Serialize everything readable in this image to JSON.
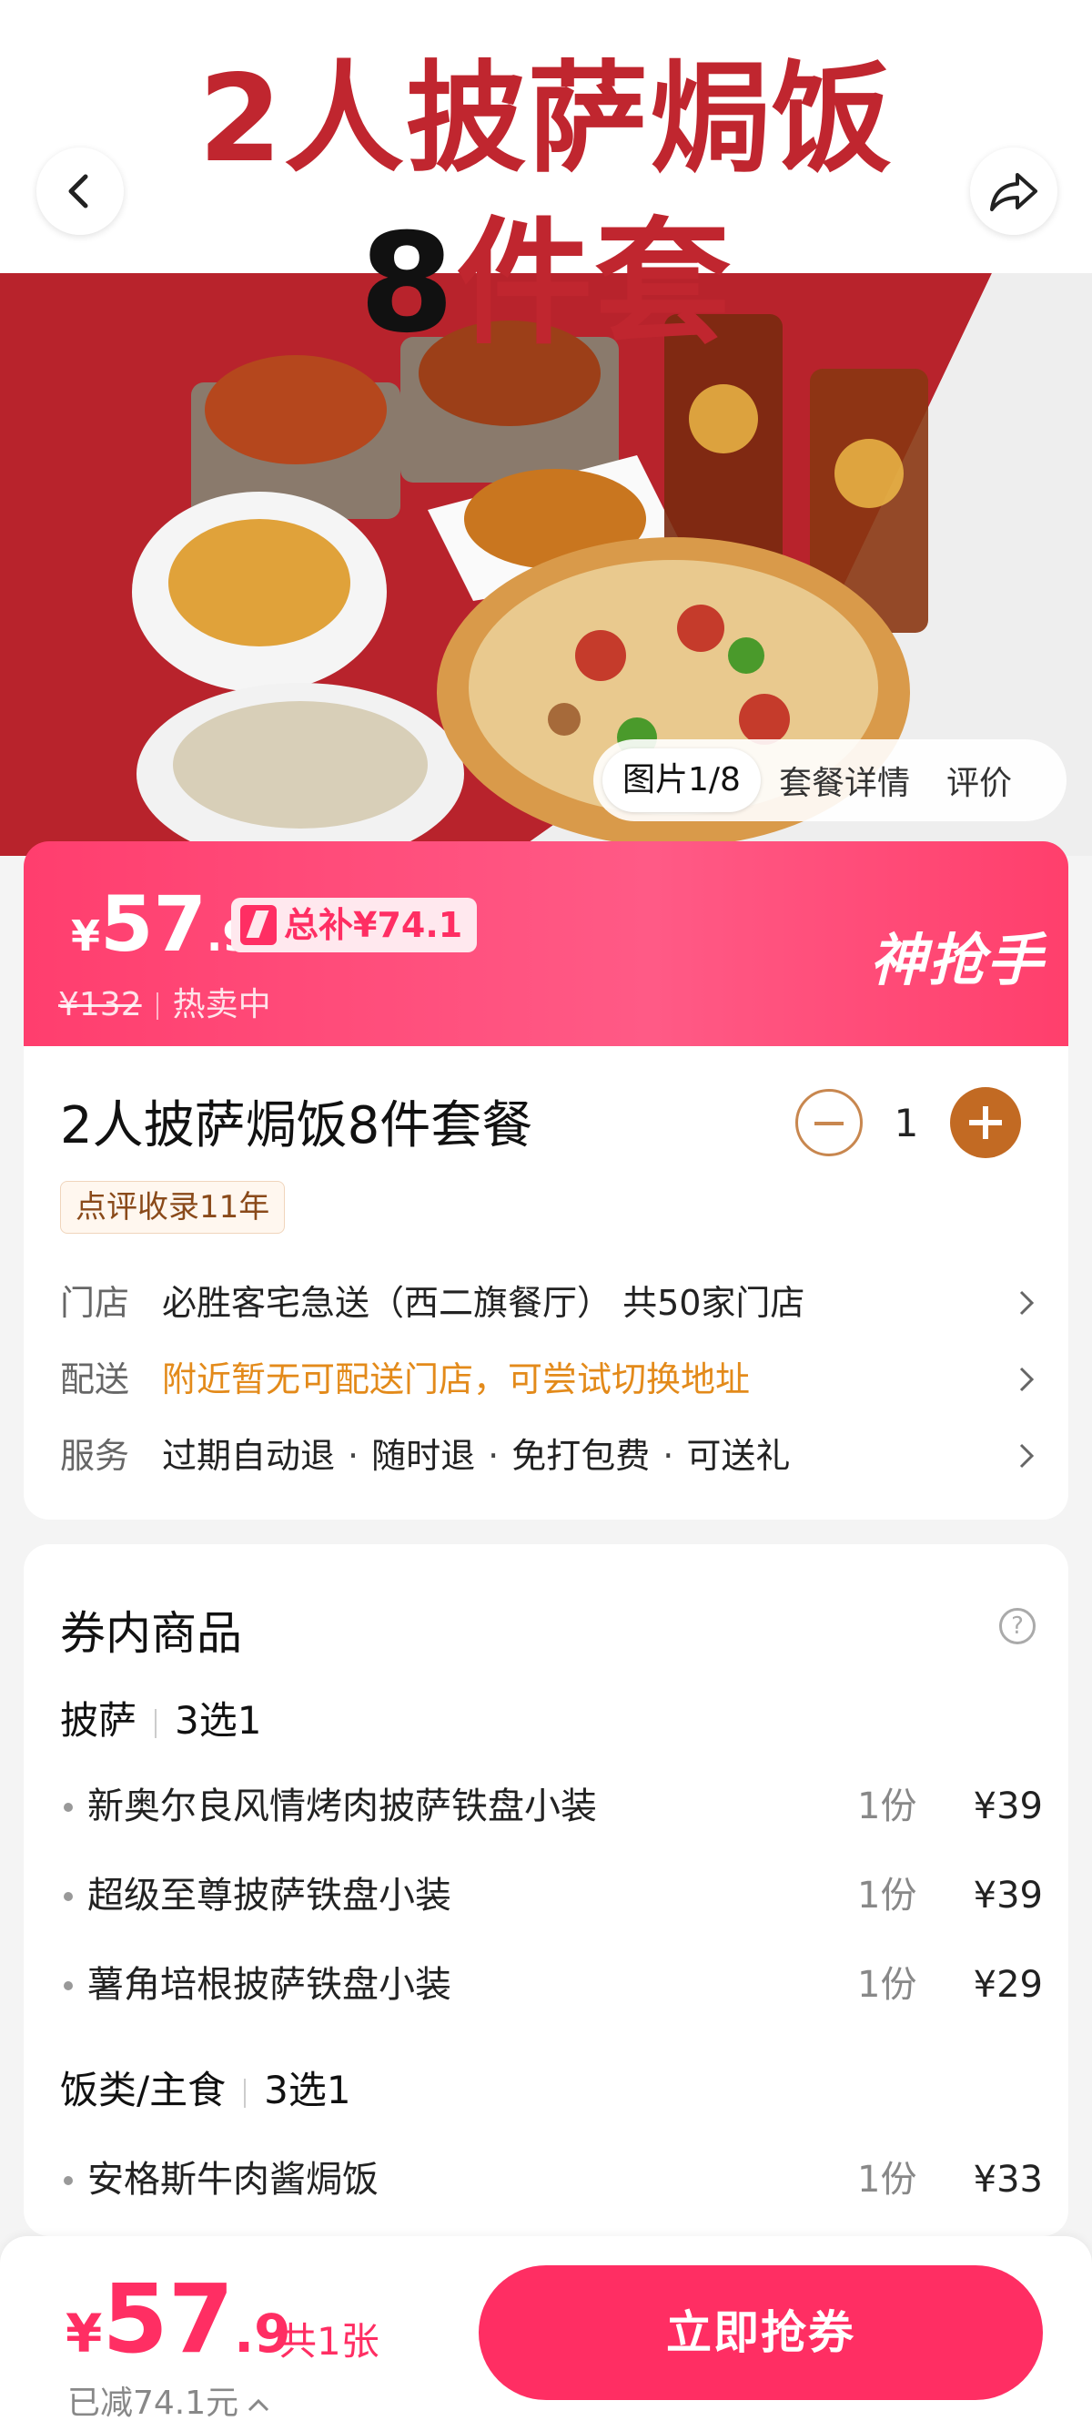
{
  "hero": {
    "title_line1": "2人披萨焗饭",
    "title_line2_num": "8",
    "title_line2_text": "件套",
    "tabs": [
      "图片1/8",
      "套餐详情",
      "评价"
    ],
    "active_tab": "图片1/8"
  },
  "price_banner": {
    "currency": "¥",
    "price_int": "57",
    "price_dec": ".9",
    "subsidy": "总补¥74.1",
    "original_price": "¥132",
    "status": "热卖中",
    "brand": "神抢手"
  },
  "product": {
    "title": "2人披萨焗饭8件套餐",
    "quantity": "1",
    "tag": "点评收录11年",
    "store_label": "门店",
    "store_value": "必胜客宅急送（西二旗餐厅）  共50家门店",
    "delivery_label": "配送",
    "delivery_value": "附近暂无可配送门店，可尝试切换地址",
    "service_label": "服务",
    "services": [
      "过期自动退",
      "随时退",
      "免打包费",
      "可送礼"
    ],
    "service_sep": "·"
  },
  "coupon_items": {
    "heading": "券内商品",
    "groups": [
      {
        "name": "披萨",
        "rule": "3选1",
        "items": [
          {
            "name": "新奥尔良风情烤肉披萨铁盘小装",
            "qty": "1份",
            "price": "¥39"
          },
          {
            "name": "超级至尊披萨铁盘小装",
            "qty": "1份",
            "price": "¥39"
          },
          {
            "name": "薯角培根披萨铁盘小装",
            "qty": "1份",
            "price": "¥29"
          }
        ]
      },
      {
        "name": "饭类/主食",
        "rule": "3选1",
        "items": [
          {
            "name": "安格斯牛肉酱焗饭",
            "qty": "1份",
            "price": "¥33"
          }
        ]
      }
    ]
  },
  "bottom_bar": {
    "currency": "¥",
    "price_int": "57",
    "price_dec": ".9",
    "count": "共1张",
    "saved": "已减74.1元",
    "button": "立即抢券"
  },
  "colors": {
    "accent": "#ff2e63",
    "hero_red": "#b8232c",
    "gold": "#c26a23",
    "orange_notice": "#e38a1a"
  },
  "icons": {
    "back": "chevron-left-icon",
    "share": "share-icon",
    "chevron": "chevron-right-icon",
    "help": "question-circle-icon"
  }
}
